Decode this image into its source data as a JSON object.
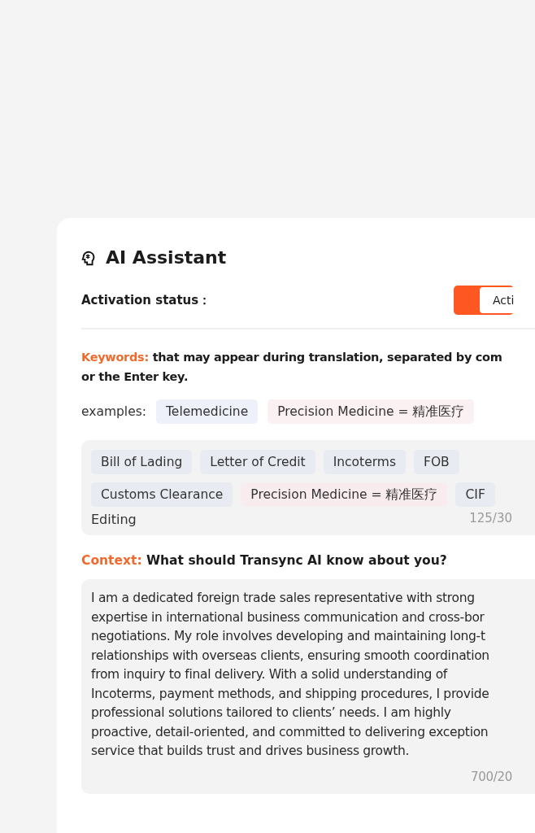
{
  "title": "AI Assistant",
  "activation": {
    "label": "Activation status：",
    "on": true,
    "status": "Acti"
  },
  "keywords": {
    "label": "Keywords:",
    "lines": [
      "that may appear during translation, separated by com",
      "or the Enter key."
    ],
    "examples_label": "examples:",
    "examples": [
      {
        "text": "Telemedicine",
        "kind": "term"
      },
      {
        "text": "Precision Medicine = 精准医疗",
        "kind": "mapping"
      }
    ],
    "tags": [
      {
        "text": "Bill of Lading",
        "kind": "term"
      },
      {
        "text": "Letter of Credit",
        "kind": "term"
      },
      {
        "text": "Incoterms",
        "kind": "term"
      },
      {
        "text": "FOB",
        "kind": "term"
      },
      {
        "text": "Customs Clearance",
        "kind": "term"
      },
      {
        "text": "Precision Medicine = 精准医疗",
        "kind": "mapping"
      },
      {
        "text": "CIF",
        "kind": "term"
      }
    ],
    "input_value": "Editing",
    "count": "125/30"
  },
  "context": {
    "label": "Context:",
    "question": "What should Transync AI know about you?",
    "lines": [
      "I am a dedicated foreign trade sales representative with strong",
      "expertise in international business communication and cross-bor",
      "negotiations. My role involves developing and maintaining long-t",
      "relationships with overseas clients, ensuring smooth coordination",
      "from inquiry to final delivery. With a solid understanding of",
      "Incoterms, payment methods, and shipping procedures, I provide",
      "professional solutions tailored to clients’ needs. I am highly",
      "proactive, detail-oriented, and committed to delivering exception",
      "service that builds trust and drives business growth."
    ],
    "count": "700/20"
  }
}
